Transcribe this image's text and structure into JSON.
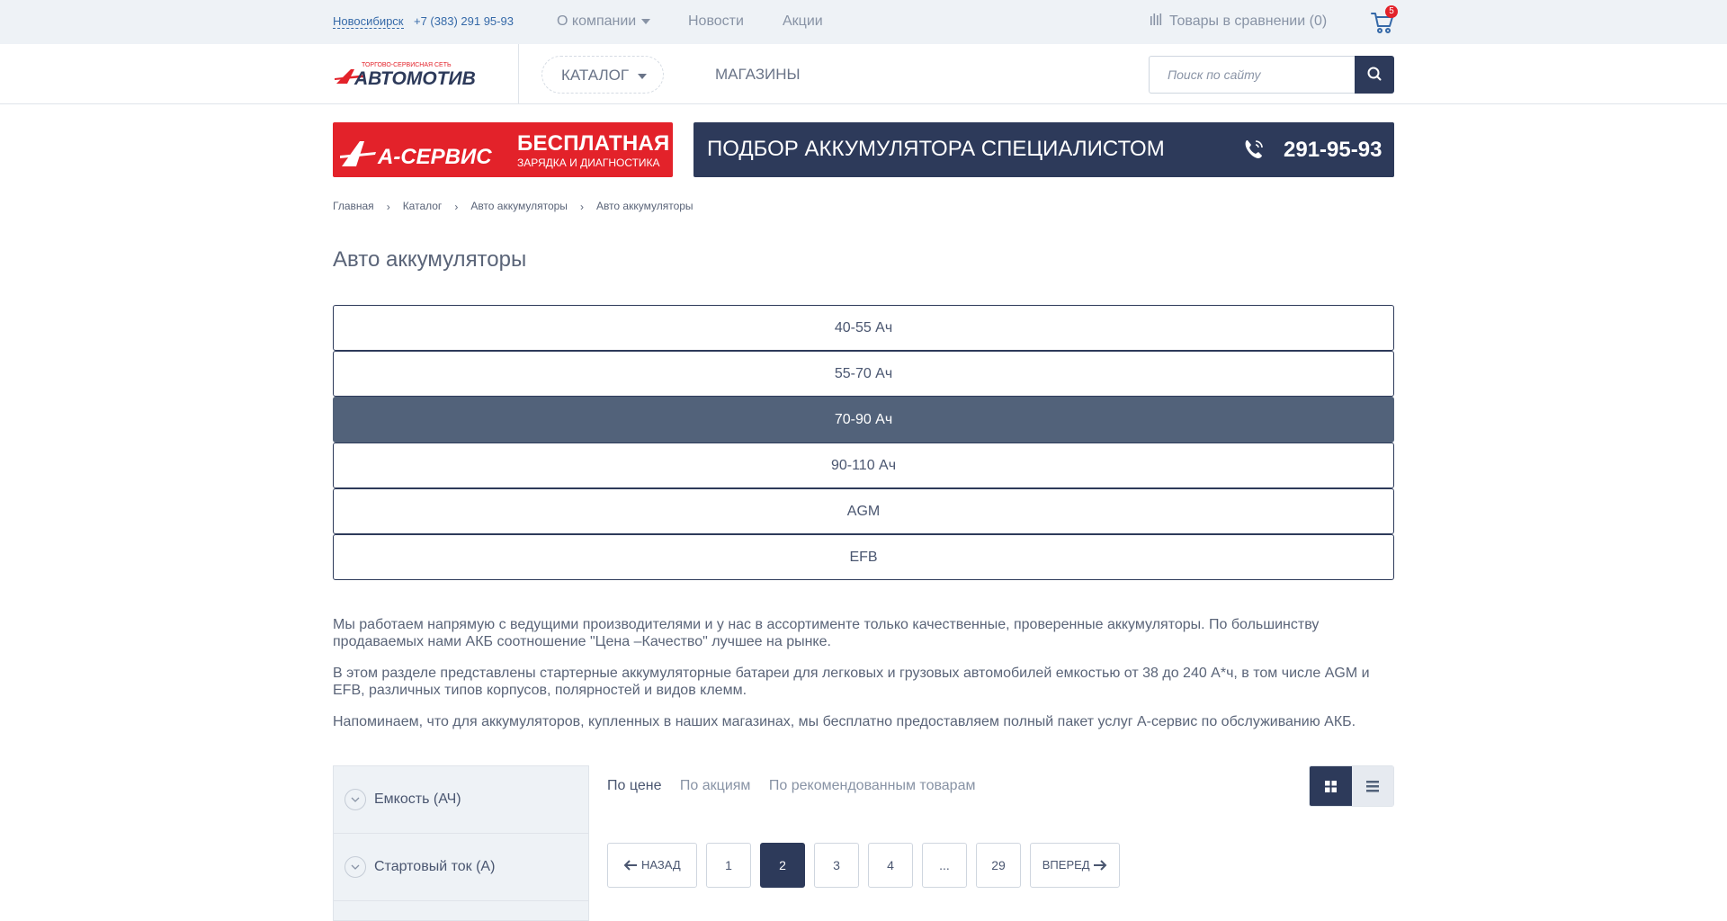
{
  "topbar": {
    "city": "Новосибирск",
    "phone": "+7 (383) 291 95-93",
    "nav": [
      "О компании",
      "Новости",
      "Акции"
    ],
    "compare": "Товары в сравнении (0)",
    "cart_count": "5"
  },
  "header": {
    "logo_tagline": "ТОРГОВО-СЕРВИСНАЯ СЕТЬ",
    "logo_name": "АВТОМОТИВ",
    "catalog": "КАТАЛОГ",
    "shops": "МАГАЗИНЫ",
    "search_placeholder": "Поиск по сайту"
  },
  "banners": {
    "service_logo": "А-СЕРВИС",
    "free_title": "БЕСПЛАТНАЯ",
    "free_sub": "ЗАРЯДКА И ДИАГНОСТИКА",
    "pick_title": "ПОДБОР АККУМУЛЯТОРА СПЕЦИАЛИСТОМ",
    "pick_phone": "291-95-93"
  },
  "breadcrumbs": [
    "Главная",
    "Каталог",
    "Авто аккумуляторы",
    "Авто аккумуляторы"
  ],
  "page_title": "Авто аккумуляторы",
  "categories": [
    {
      "label": "40-55 Ач",
      "active": false
    },
    {
      "label": "55-70 Ач",
      "active": false
    },
    {
      "label": "70-90 Ач",
      "active": true
    },
    {
      "label": "90-110 Ач",
      "active": false
    },
    {
      "label": "AGM",
      "active": false
    },
    {
      "label": "EFB",
      "active": false
    }
  ],
  "description": [
    "Мы работаем напрямую с ведущими производителями и у нас в ассортименте только качественные, проверенные аккумуляторы. По большинству продаваемых нами АКБ соотношение \"Цена –Качество\" лучшее на рынке.",
    "В этом разделе представлены стартерные аккумуляторные батареи для легковых и грузовых автомобилей емкостью от 38 до 240 А*ч, в том числе AGM и EFB, различных типов корпусов, полярностей и видов клемм.",
    "Напоминаем, что для аккумуляторов, купленных в наших магазинах, мы бесплатно предоставляем полный пакет услуг А-сервис по обслуживанию АКБ."
  ],
  "filters": [
    "Емкость (АЧ)",
    "Стартовый ток (А)"
  ],
  "sort": [
    "По цене",
    "По акциям",
    "По рекомендованным товарам"
  ],
  "pagination": {
    "prev": "НАЗАД",
    "next": "ВПЕРЕД",
    "pages": [
      "1",
      "2",
      "3",
      "4",
      "...",
      "29"
    ],
    "current": "2"
  },
  "colors": {
    "accent_red": "#e3222a",
    "navy": "#2d3a5a",
    "active_category": "#52627a",
    "link_blue": "#3569a8"
  }
}
